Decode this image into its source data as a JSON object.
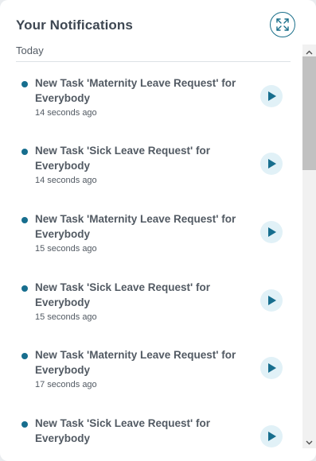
{
  "header": {
    "title": "Your Notifications",
    "expand_icon": "expand-arrows-icon"
  },
  "section": {
    "label": "Today"
  },
  "colors": {
    "accent": "#176e8e",
    "play_bg": "#e1f1f7",
    "text": "#525a63",
    "title_text": "#3e4752"
  },
  "notifications": [
    {
      "title": "New Task 'Maternity Leave Request' for Everybody",
      "time": "14 seconds ago"
    },
    {
      "title": "New Task 'Sick Leave Request' for Everybody",
      "time": "14 seconds ago"
    },
    {
      "title": "New Task 'Maternity Leave Request' for Everybody",
      "time": "15 seconds ago"
    },
    {
      "title": "New Task 'Sick Leave Request' for Everybody",
      "time": "15 seconds ago"
    },
    {
      "title": "New Task 'Maternity Leave Request' for Everybody",
      "time": "17 seconds ago"
    },
    {
      "title": "New Task 'Sick Leave Request' for Everybody",
      "time": ""
    }
  ]
}
